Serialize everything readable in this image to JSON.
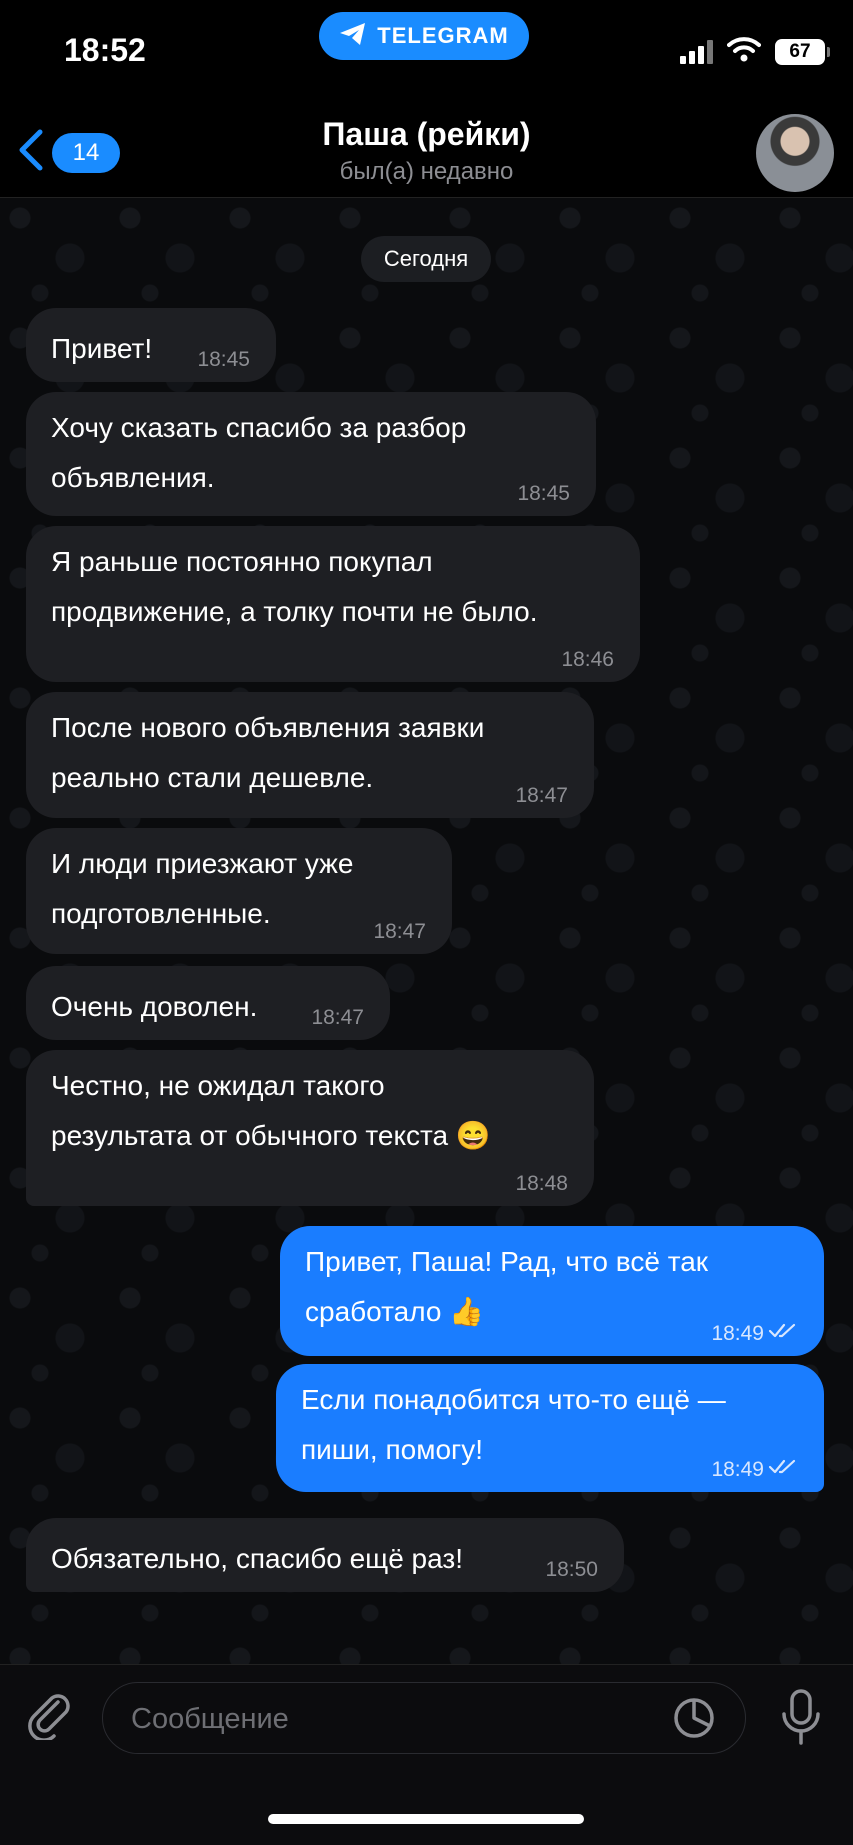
{
  "status_bar": {
    "time": "18:52",
    "app_pill": "TELEGRAM",
    "battery": "67"
  },
  "header": {
    "back_count": "14",
    "title": "Паша (рейки)",
    "subtitle": "был(а) недавно"
  },
  "date_separator": "Сегодня",
  "messages": [
    {
      "direction": "incoming",
      "text": "Привет!",
      "time": "18:45"
    },
    {
      "direction": "incoming",
      "text": "Хочу сказать спасибо за разбор\nобъявления.",
      "time": "18:45"
    },
    {
      "direction": "incoming",
      "text": "Я раньше постоянно покупал\nпродвижение, а толку почти не было.",
      "time": "18:46"
    },
    {
      "direction": "incoming",
      "text": "После нового объявления заявки\nреально стали дешевле.",
      "time": "18:47"
    },
    {
      "direction": "incoming",
      "text": "И люди приезжают уже\nподготовленные.",
      "time": "18:47"
    },
    {
      "direction": "incoming",
      "text": "Очень доволен.",
      "time": "18:47"
    },
    {
      "direction": "incoming",
      "text": "Честно, не ожидал такого\nрезультата от обычного текста 😄",
      "time": "18:48"
    },
    {
      "direction": "outgoing",
      "text": "Привет, Паша! Рад, что всё так\nсработало 👍",
      "time": "18:49",
      "read": true
    },
    {
      "direction": "outgoing",
      "text": "Если понадобится что-то ещё —\nпиши, помогу!",
      "time": "18:49",
      "read": true
    },
    {
      "direction": "incoming",
      "text": "Обязательно, спасибо ещё раз!",
      "time": "18:50"
    }
  ],
  "composer": {
    "placeholder": "Сообщение"
  },
  "colors": {
    "accent": "#1a8cff",
    "outgoing_bubble": "#1a7dff",
    "incoming_bubble": "#1e1f23",
    "background": "#000000"
  },
  "icons": [
    "telegram-logo-icon",
    "signal-icon",
    "wifi-icon",
    "battery-icon",
    "back-chevron-icon",
    "attach-icon",
    "sticker-icon",
    "microphone-icon",
    "double-check-icon"
  ]
}
